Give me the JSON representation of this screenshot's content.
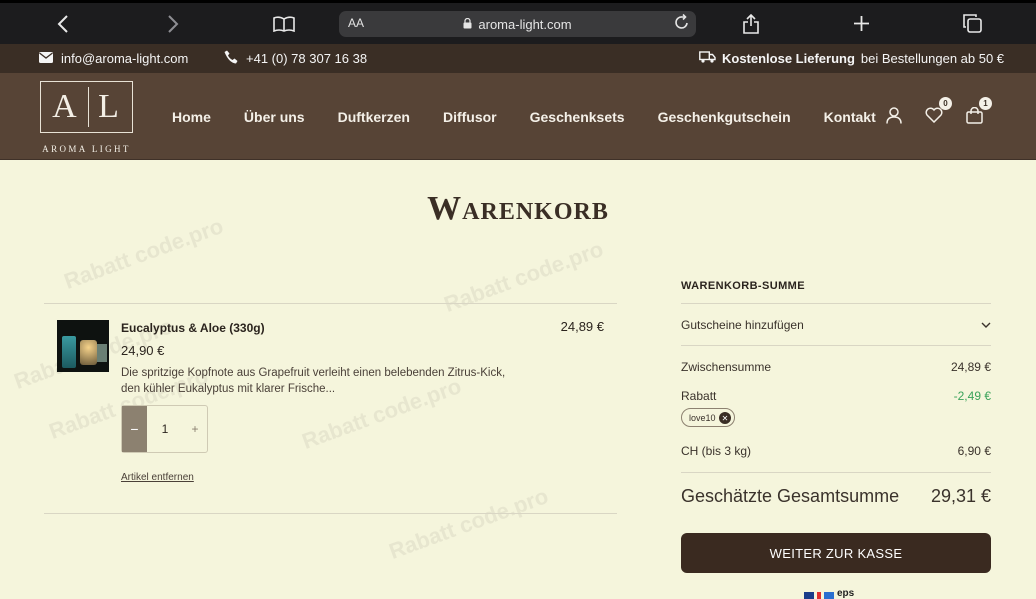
{
  "browser": {
    "url": "aroma-light.com",
    "reader_label": "AA",
    "icons": [
      "back-icon",
      "forward-icon",
      "book-icon",
      "lock-icon",
      "reload-icon",
      "share-icon",
      "plus-icon",
      "tabs-icon"
    ]
  },
  "infobar": {
    "email": "info@aroma-light.com",
    "phone": "+41 (0) 78 307 16 38",
    "delivery_bold": "Kostenlose Lieferung",
    "delivery_rest": "bei Bestellungen ab 50 €"
  },
  "logo": {
    "letters_left": "A",
    "letters_right": "L",
    "tagline": "AROMA LIGHT"
  },
  "nav": {
    "items": [
      "Home",
      "Über uns",
      "Duftkerzen",
      "Diffusor",
      "Geschenksets",
      "Geschenkgutschein",
      "Kontakt"
    ],
    "wishlist_count": "0",
    "cart_count": "1"
  },
  "page": {
    "title": "Warenkorb"
  },
  "cart": {
    "item": {
      "name": "Eucalyptus & Aloe (330g)",
      "price": "24,90 €",
      "description": "Die spritzige Kopfnote aus Grapefruit verleiht einen belebenden Zitrus-Kick, den kühler Eukalyptus mit klarer Frische...",
      "quantity": "1",
      "minus": "−",
      "plus": "+",
      "line_total": "24,89 €",
      "remove_label": "Artikel entfernen"
    }
  },
  "summary": {
    "title": "WARENKORB-SUMME",
    "coupon_label": "Gutscheine hinzufügen",
    "subtotal_label": "Zwischensumme",
    "subtotal_value": "24,89 €",
    "discount_label": "Rabatt",
    "discount_value": "-2,49 €",
    "coupon_code": "love10",
    "shipping_label": "CH (bis 3 kg)",
    "shipping_value": "6,90 €",
    "total_label": "Geschätzte Gesamtsumme",
    "total_value": "29,31 €",
    "checkout_label": "WEITER ZUR KASSE",
    "payment_text": "eps"
  },
  "watermark": "Rabatt code.pro",
  "colors": {
    "header": "#574436",
    "infobar": "#3a2e25",
    "background": "#f5f5dc",
    "checkout": "#3a2a20",
    "discount": "#3aa35a"
  }
}
